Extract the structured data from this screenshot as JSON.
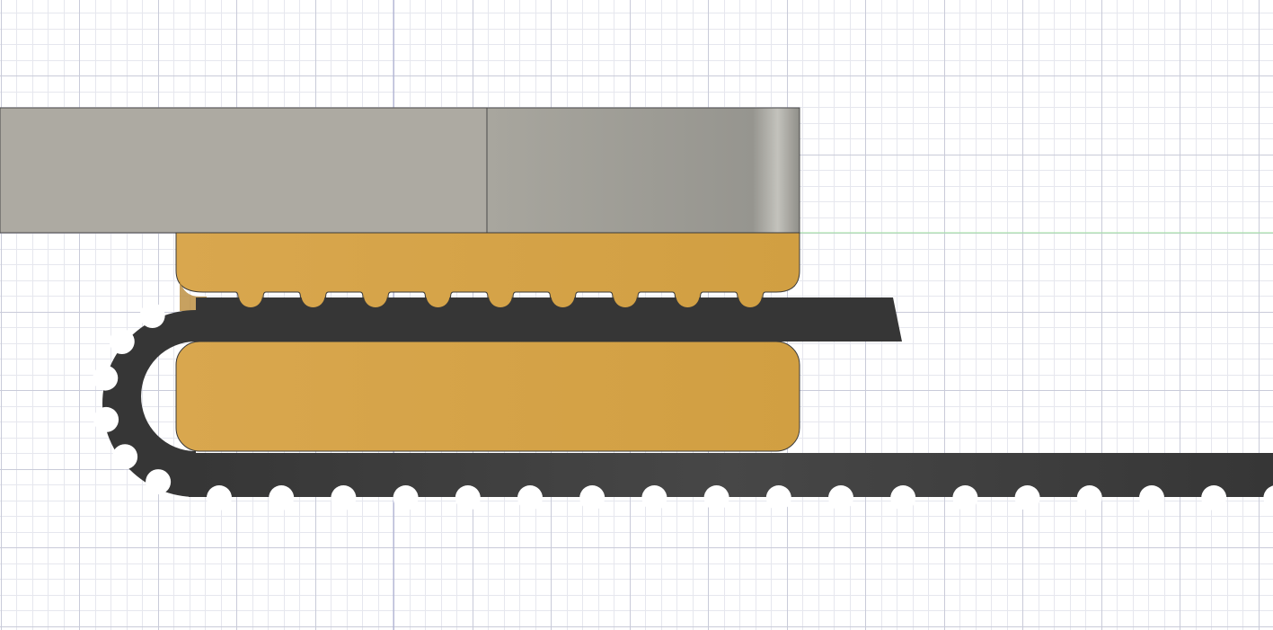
{
  "canvas": {
    "background": "#ffffff",
    "grid_minor_color": "#e6e7ee",
    "grid_major_color": "#c9cbd9",
    "axis_vertical_color": "#a9aed2",
    "axis_horizontal_color": "#9fe39f"
  },
  "parts": {
    "top_block": {
      "left_face_color": "#adaaa2",
      "right_face_light": "#a8a69e",
      "right_face_dark": "#96958f",
      "edge_color": "#4a4a4a"
    },
    "housing": {
      "color_light": "#d9a74e",
      "color_dark": "#d19f42",
      "shadow_color": "#b98a38",
      "edge_color": "#3a3a3a"
    },
    "belt": {
      "color": "#363636",
      "color_highlight": "#474747"
    }
  }
}
